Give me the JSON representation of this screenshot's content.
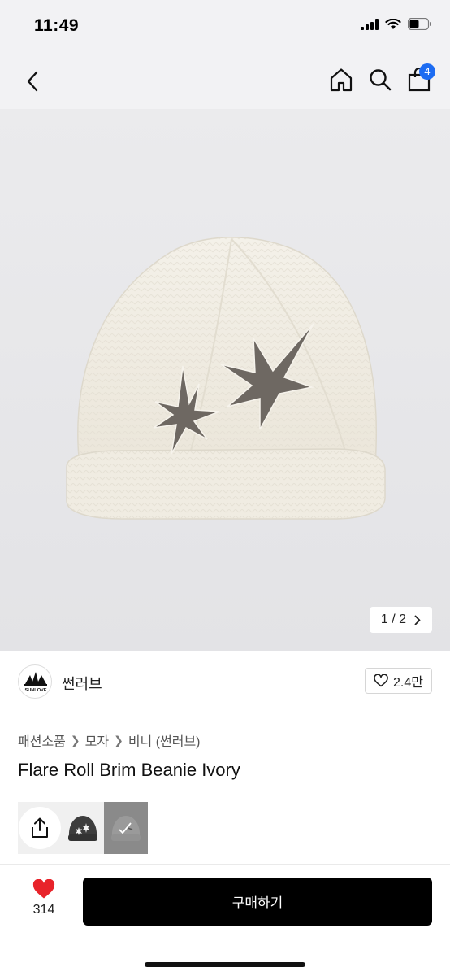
{
  "status_bar": {
    "time": "11:49"
  },
  "nav": {
    "cart_count": "4"
  },
  "hero": {
    "image_counter": "1 / 2"
  },
  "brand": {
    "name": "썬러브",
    "logo_text": "SUNLOVE",
    "like_count": "2.4만"
  },
  "breadcrumb": {
    "items": [
      "패션소품",
      "모자",
      "비니 (썬러브)"
    ]
  },
  "product": {
    "title": "Flare Roll Brim Beanie Ivory"
  },
  "actions": {
    "like_count": "314",
    "buy_label": "구매하기"
  },
  "colors": {
    "accent": "#1d6cf2",
    "like_red": "#e8232a",
    "buy_bg": "#000000",
    "beanie_ivory": "#f1ede3",
    "star_gray": "#6e6862"
  }
}
